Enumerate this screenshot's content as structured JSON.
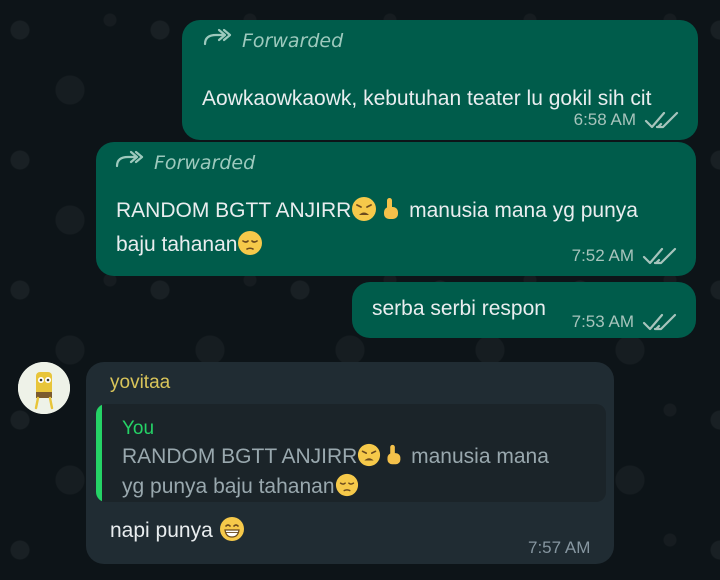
{
  "chat": {
    "messages": [
      {
        "direction": "outgoing",
        "forwarded_label": "Forwarded",
        "text": "Aowkaowkaowk, kebutuhan teater lu gokil sih cit",
        "time": "6:58 AM",
        "status": "read"
      },
      {
        "direction": "outgoing",
        "forwarded_label": "Forwarded",
        "text_part1": "RANDOM BGTT ANJIRR",
        "text_part2": " manusia mana yg punya",
        "text_part3": "baju tahanan",
        "emojis": [
          "weary-face-icon",
          "pointing-up-icon",
          "pensive-face-icon"
        ],
        "time": "7:52 AM",
        "status": "read"
      },
      {
        "direction": "outgoing",
        "text": "serba serbi respon",
        "time": "7:53 AM",
        "status": "read"
      },
      {
        "direction": "incoming",
        "sender": "yovitaa",
        "quote": {
          "author": "You",
          "text_part1": "RANDOM BGTT ANJIRR",
          "text_part2": " manusia mana",
          "text_part3": "yg punya baju tahanan"
        },
        "text": "napi punya",
        "emoji": "grinning-face-icon",
        "time": "7:57 AM"
      }
    ]
  },
  "colors": {
    "outgoing_bubble": "#005c4b",
    "incoming_bubble": "#202c33",
    "background": "#0b141a",
    "sender_name": "#d9c55a",
    "quote_accent": "#25d366"
  }
}
